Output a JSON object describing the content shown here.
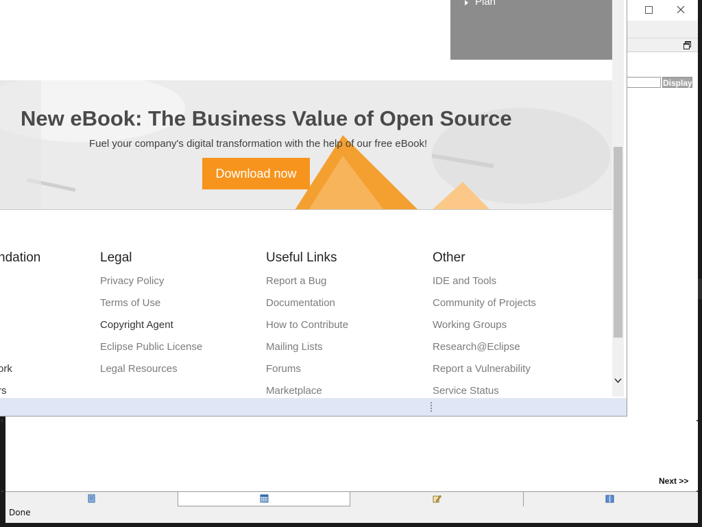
{
  "menu": {
    "plan_label": "Plan"
  },
  "banner": {
    "title": "New eBook: The Business Value of Open Source",
    "subtitle": "Fuel your company's digital transformation with the help of our free eBook!",
    "download_label": "Download now"
  },
  "footer": {
    "foundation": {
      "heading": "ndation",
      "links": [
        "ork",
        "rs"
      ]
    },
    "legal": {
      "heading": "Legal",
      "links": [
        "Privacy Policy",
        "Terms of Use",
        "Copyright Agent",
        "Eclipse Public License",
        "Legal Resources"
      ]
    },
    "useful": {
      "heading": "Useful Links",
      "links": [
        "Report a Bug",
        "Documentation",
        "How to Contribute",
        "Mailing Lists",
        "Forums",
        "Marketplace"
      ]
    },
    "other": {
      "heading": "Other",
      "links": [
        "IDE and Tools",
        "Community of Projects",
        "Working Groups",
        "Research@Eclipse",
        "Report a Vulnerability",
        "Service Status"
      ]
    }
  },
  "background_app": {
    "display_label": "Display",
    "next_label": "Next >>",
    "status_text": "Done",
    "tab_icons": [
      "document-icon",
      "calendar-grid-icon",
      "pencil-edit-icon",
      "book-icon"
    ]
  },
  "colors": {
    "accent_orange": "#f7941d",
    "menu_gray": "#8c8c8c",
    "statusbar_blue": "#dfe6f5"
  }
}
